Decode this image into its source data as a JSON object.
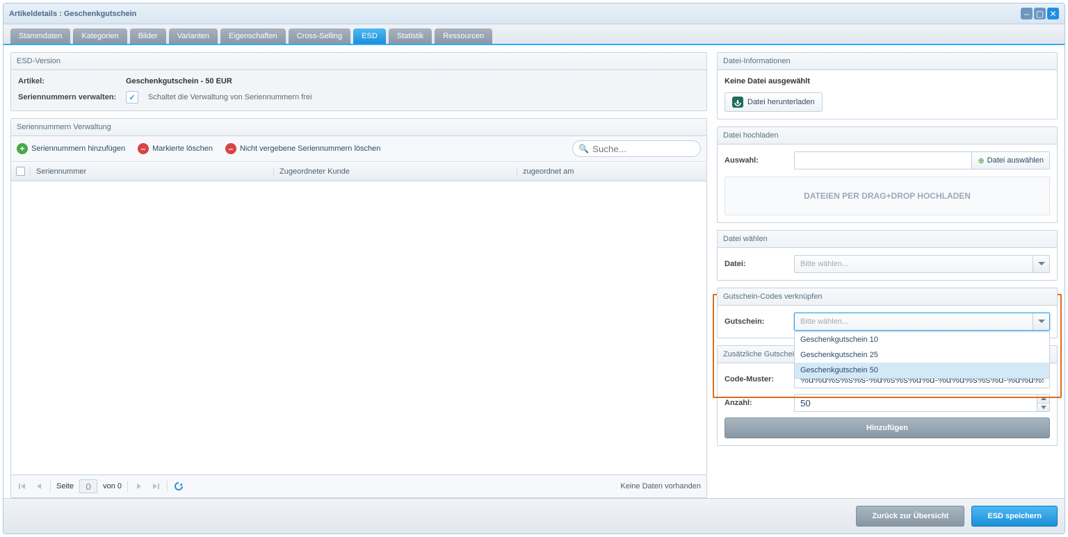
{
  "window": {
    "title": "Artikeldetails : Geschenkgutschein"
  },
  "tabs": [
    {
      "label": "Stammdaten"
    },
    {
      "label": "Kategorien"
    },
    {
      "label": "Bilder"
    },
    {
      "label": "Varianten"
    },
    {
      "label": "Eigenschaften"
    },
    {
      "label": "Cross-Selling"
    },
    {
      "label": "ESD",
      "active": true
    },
    {
      "label": "Statistik"
    },
    {
      "label": "Ressourcen"
    }
  ],
  "esd_version": {
    "title": "ESD-Version",
    "article_label": "Artikel:",
    "article_value": "Geschenkgutschein - 50 EUR",
    "serial_manage_label": "Seriennummern verwalten:",
    "serial_manage_help": "Schaltet die Verwaltung von Seriennummern frei",
    "checked": "✓"
  },
  "serial_panel": {
    "title": "Seriennummern Verwaltung",
    "actions": {
      "add": "Seriennummern hinzufügen",
      "delete_marked": "Markierte löschen",
      "delete_unassigned": "Nicht vergebene Seriennummern löschen"
    },
    "search_placeholder": "Suche...",
    "columns": {
      "serial": "Seriennummer",
      "customer": "Zugeordneter Kunde",
      "date": "zugeordnet am"
    },
    "pager": {
      "page_label": "Seite",
      "page": "0",
      "of": "von 0",
      "status": "Keine Daten vorhanden"
    }
  },
  "file_info": {
    "title": "Datei-Informationen",
    "no_file": "Keine Datei ausgewählt",
    "download_btn": "Datei herunterladen"
  },
  "file_upload": {
    "title": "Datei hochladen",
    "selection_label": "Auswahl:",
    "choose_btn": "Datei auswählen",
    "dropzone": "DATEIEN PER DRAG+DROP HOCHLADEN"
  },
  "file_choose": {
    "title": "Datei wählen",
    "file_label": "Datei:",
    "placeholder": "Bitte wählen..."
  },
  "voucher_link": {
    "title": "Gutschein-Codes verknüpfen",
    "voucher_label": "Gutschein:",
    "placeholder": "Bitte wählen...",
    "options": [
      {
        "label": "Geschenkgutschein 10"
      },
      {
        "label": "Geschenkgutschein 25"
      },
      {
        "label": "Geschenkgutschein 50",
        "highlight": true
      }
    ]
  },
  "extra_options": {
    "title": "Zusätzliche Gutschein-",
    "pattern_label": "Code-Muster:",
    "pattern_value": "%d%d%s%s%s-%d%s%s%d%d-%d%d%s%s%d-%d%d%s%s%s",
    "count_label": "Anzahl:",
    "count_value": "50",
    "add_btn": "Hinzufügen"
  },
  "footer": {
    "back": "Zurück zur Übersicht",
    "save": "ESD speichern"
  }
}
